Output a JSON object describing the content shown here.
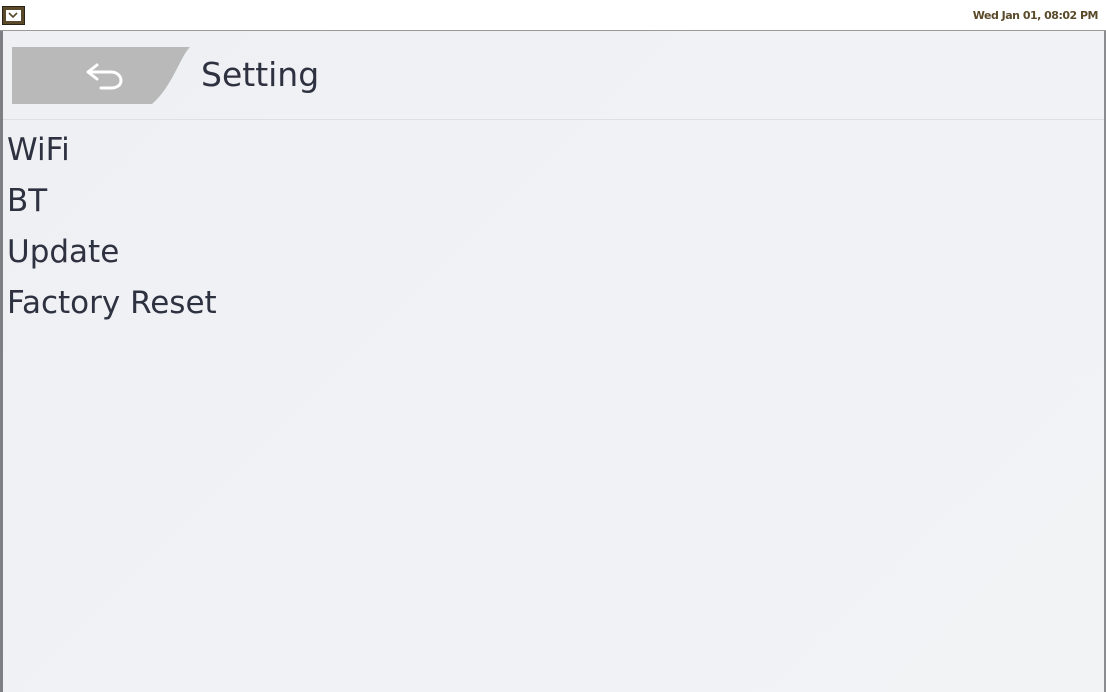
{
  "taskbar": {
    "app_icon": "monitor-icon",
    "clock": "Wed Jan 01, 08:02 PM"
  },
  "header": {
    "back_icon": "back-arrow-icon",
    "title": "Setting"
  },
  "menu": {
    "items": [
      {
        "label": "WiFi"
      },
      {
        "label": "BT"
      },
      {
        "label": "Update"
      },
      {
        "label": "Factory Reset"
      }
    ]
  },
  "colors": {
    "background": "#eff1f4",
    "text": "#2e3240",
    "back_button": "#b8b9b8",
    "clock_text": "#5a4a2a"
  }
}
